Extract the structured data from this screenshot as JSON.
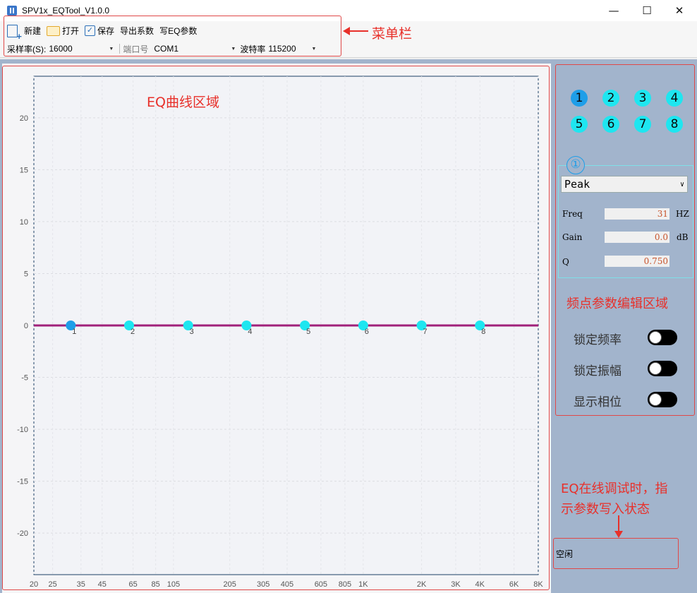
{
  "window": {
    "title": "SPV1x_EQTool_V1.0.0",
    "minimize_glyph": "—",
    "maximize_glyph": "☐",
    "close_glyph": "✕"
  },
  "toolbar": {
    "new_label": "新建",
    "open_label": "打开",
    "save_label": "保存",
    "export_label": "导出系数",
    "write_label": "写EQ参数",
    "sample_rate_label": "采样率(S):",
    "sample_rate_value": "16000",
    "port_label": "端口号",
    "port_value": "COM1",
    "baud_label": "波特率",
    "baud_value": "115200"
  },
  "annotations": {
    "menu": "菜单栏",
    "eq_area": "EQ曲线区域",
    "editor_area": "频点参数编辑区域",
    "status_note_line1": "EQ在线调试时，指",
    "status_note_line2": "示参数写入状态"
  },
  "bands": {
    "buttons": [
      "1",
      "2",
      "3",
      "4",
      "5",
      "6",
      "7",
      "8"
    ],
    "selected": "1",
    "editor_circle": "①",
    "filter_type": "Peak",
    "freq_label": "Freq",
    "freq_value": "31",
    "freq_unit": "HZ",
    "gain_label": "Gain",
    "gain_value": "0.0",
    "gain_unit": "dB",
    "q_label": "Q",
    "q_value": "0.750"
  },
  "toggles": {
    "lock_freq": "锁定频率",
    "lock_amp": "锁定振幅",
    "show_phase": "显示相位",
    "lock_freq_on": false,
    "lock_amp_on": false,
    "show_phase_on": false
  },
  "status": {
    "text": "空闲"
  },
  "colors": {
    "curve": "#a0207a",
    "point": "#1ee6f0",
    "point_active": "#1e9ee8",
    "annotation": "#e8302a",
    "panel_bg": "#a2b4cc"
  },
  "chart_data": {
    "type": "line",
    "title": "",
    "xlabel": "",
    "ylabel": "",
    "x_scale": "log",
    "xlim": [
      20,
      8000
    ],
    "ylim": [
      -24,
      24
    ],
    "x_ticks": [
      {
        "v": 20,
        "label": "20"
      },
      {
        "v": 25,
        "label": "25"
      },
      {
        "v": 35,
        "label": "35"
      },
      {
        "v": 45,
        "label": "45"
      },
      {
        "v": 65,
        "label": "65"
      },
      {
        "v": 85,
        "label": "85"
      },
      {
        "v": 105,
        "label": "105"
      },
      {
        "v": 205,
        "label": "205"
      },
      {
        "v": 305,
        "label": "305"
      },
      {
        "v": 405,
        "label": "405"
      },
      {
        "v": 605,
        "label": "605"
      },
      {
        "v": 805,
        "label": "805"
      },
      {
        "v": 1000,
        "label": "1K"
      },
      {
        "v": 2000,
        "label": "2K"
      },
      {
        "v": 3000,
        "label": "3K"
      },
      {
        "v": 4000,
        "label": "4K"
      },
      {
        "v": 6000,
        "label": "6K"
      },
      {
        "v": 8000,
        "label": "8K"
      }
    ],
    "y_ticks": [
      20,
      15,
      10,
      5,
      0,
      -5,
      -10,
      -15,
      -20
    ],
    "grid": true,
    "series": [
      {
        "values_x": [
          20,
          8000
        ],
        "values_y": [
          0,
          0
        ]
      }
    ],
    "points": [
      {
        "label": "1",
        "freq": 31,
        "gain": 0
      },
      {
        "label": "2",
        "freq": 62,
        "gain": 0
      },
      {
        "label": "3",
        "freq": 125,
        "gain": 0
      },
      {
        "label": "4",
        "freq": 250,
        "gain": 0
      },
      {
        "label": "5",
        "freq": 500,
        "gain": 0
      },
      {
        "label": "6",
        "freq": 1000,
        "gain": 0
      },
      {
        "label": "7",
        "freq": 2000,
        "gain": 0
      },
      {
        "label": "8",
        "freq": 4000,
        "gain": 0
      }
    ]
  }
}
